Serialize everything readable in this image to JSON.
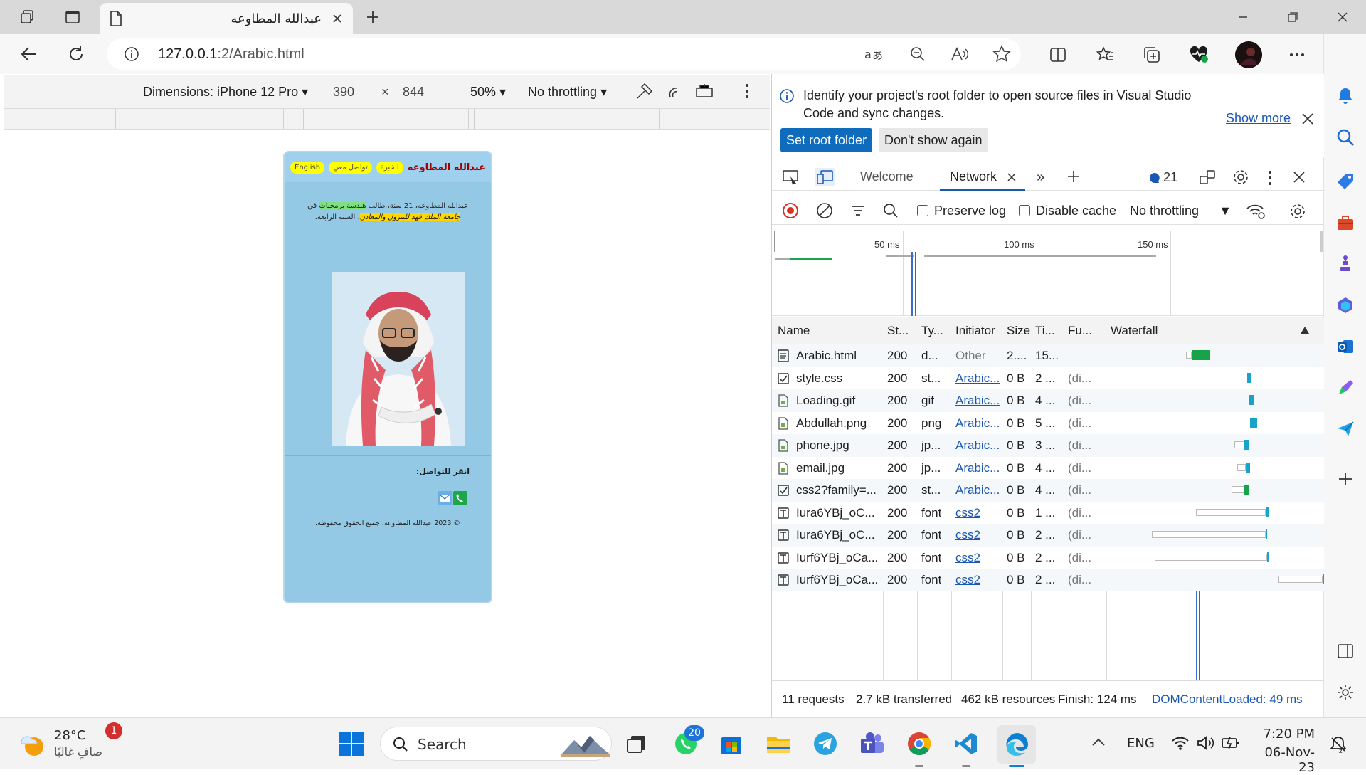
{
  "browser": {
    "tab_title": "عبدالله المطاوعه",
    "url_host": "127.0.0.1",
    "url_path": ":2/Arabic.html"
  },
  "device_toolbar": {
    "dimensions_label": "Dimensions: iPhone 12 Pro",
    "width": "390",
    "times": "×",
    "height": "844",
    "zoom": "50%",
    "throttling": "No throttling"
  },
  "site": {
    "name": "عبدالله المطاوعه",
    "nav": [
      "English",
      "تواصل معي",
      "الخبرة"
    ],
    "bio_part1": "عبدالله المطاوعه، 21 سنة، طالب ",
    "bio_hl1": "هندسة برمجيات",
    "bio_part2": " في ",
    "bio_hl2": "جامعة الملك فهد للبترول والمعادن",
    "bio_part3": "، السنة الرابعة.",
    "contact_title": "انقر للتواصل:",
    "copyright": "© 2023 عبدالله المطاوعه، جميع الحقوق محفوظة."
  },
  "devtools": {
    "info_text": "Identify your project's root folder to open source files in Visual Studio Code and sync changes.",
    "show_more": "Show more",
    "set_root": "Set root folder",
    "dont_show": "Don't show again",
    "tab_welcome": "Welcome",
    "tab_network": "Network",
    "issues_count": "21",
    "preserve_log": "Preserve log",
    "disable_cache": "Disable cache",
    "throttling": "No throttling",
    "overview_labels": [
      "50 ms",
      "100 ms",
      "150 ms"
    ],
    "columns": [
      "Name",
      "St...",
      "Ty...",
      "Initiator",
      "Size",
      "Ti...",
      "Fu...",
      "Waterfall"
    ],
    "rows": [
      {
        "name": "Arabic.html",
        "status": "200",
        "type": "d...",
        "initiator": "Other",
        "size": "2....",
        "time": "15...",
        "fu": ""
      },
      {
        "name": "style.css",
        "status": "200",
        "type": "st...",
        "initiator": "Arabic...",
        "size": "0 B",
        "time": "2 ...",
        "fu": "(di..."
      },
      {
        "name": "Loading.gif",
        "status": "200",
        "type": "gif",
        "initiator": "Arabic...",
        "size": "0 B",
        "time": "4 ...",
        "fu": "(di..."
      },
      {
        "name": "Abdullah.png",
        "status": "200",
        "type": "png",
        "initiator": "Arabic...",
        "size": "0 B",
        "time": "5 ...",
        "fu": "(di..."
      },
      {
        "name": "phone.jpg",
        "status": "200",
        "type": "jp...",
        "initiator": "Arabic...",
        "size": "0 B",
        "time": "3 ...",
        "fu": "(di..."
      },
      {
        "name": "email.jpg",
        "status": "200",
        "type": "jp...",
        "initiator": "Arabic...",
        "size": "0 B",
        "time": "4 ...",
        "fu": "(di..."
      },
      {
        "name": "css2?family=...",
        "status": "200",
        "type": "st...",
        "initiator": "Arabic...",
        "size": "0 B",
        "time": "4 ...",
        "fu": "(di..."
      },
      {
        "name": "Iura6YBj_oC...",
        "status": "200",
        "type": "font",
        "initiator": "css2",
        "size": "0 B",
        "time": "1 ...",
        "fu": "(di..."
      },
      {
        "name": "Iura6YBj_oC...",
        "status": "200",
        "type": "font",
        "initiator": "css2",
        "size": "0 B",
        "time": "2 ...",
        "fu": "(di..."
      },
      {
        "name": "Iurf6YBj_oCa...",
        "status": "200",
        "type": "font",
        "initiator": "css2",
        "size": "0 B",
        "time": "2 ...",
        "fu": "(di..."
      },
      {
        "name": "Iurf6YBj_oCa...",
        "status": "200",
        "type": "font",
        "initiator": "css2",
        "size": "0 B",
        "time": "2 ...",
        "fu": "(di..."
      }
    ],
    "summary": {
      "requests": "11 requests",
      "transferred": "2.7 kB transferred",
      "resources": "462 kB resources",
      "finish": "Finish: 124 ms",
      "dcl": "DOMContentLoaded: 49 ms"
    }
  },
  "taskbar": {
    "temperature": "28°C",
    "weather": "صافٍ غالبًا",
    "weather_badge": "1",
    "search": "Search",
    "whatsapp_badge": "20",
    "lang": "ENG",
    "time": "7:20 PM",
    "date": "06-Nov-23"
  }
}
